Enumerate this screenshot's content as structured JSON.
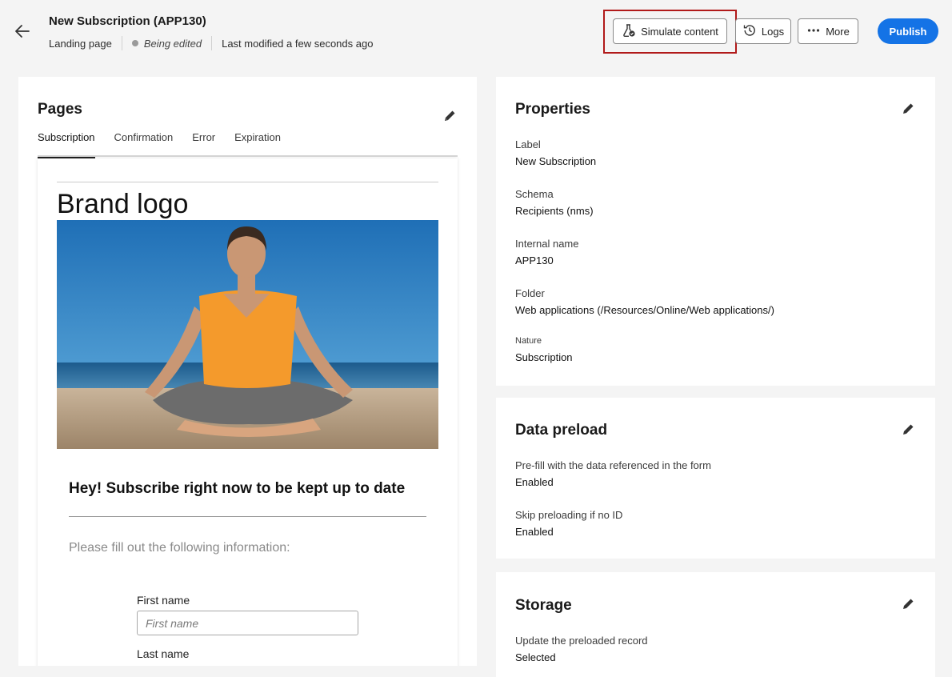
{
  "header": {
    "title": "New Subscription (APP130)",
    "type": "Landing page",
    "status": "Being edited",
    "last_modified": "Last modified a few seconds ago",
    "buttons": {
      "simulate": "Simulate content",
      "logs": "Logs",
      "more": "More",
      "publish": "Publish"
    }
  },
  "pages": {
    "heading": "Pages",
    "tabs": [
      "Subscription",
      "Confirmation",
      "Error",
      "Expiration"
    ],
    "active_tab": "Subscription",
    "preview": {
      "brand_logo": "Brand logo",
      "headline": "Hey! Subscribe right now to be kept up to date",
      "intro": "Please fill out the following information:",
      "first_name_label": "First name",
      "first_name_placeholder": "First name",
      "last_name_label": "Last name"
    }
  },
  "properties": {
    "heading": "Properties",
    "items": [
      {
        "label": "Label",
        "value": "New Subscription"
      },
      {
        "label": "Schema",
        "value": "Recipients (nms)"
      },
      {
        "label": "Internal name",
        "value": "APP130"
      },
      {
        "label": "Folder",
        "value": "Web applications (/Resources/Online/Web applications/)"
      },
      {
        "label": "Nature",
        "value": "Subscription"
      }
    ]
  },
  "data_preload": {
    "heading": "Data preload",
    "items": [
      {
        "label": "Pre-fill with the data referenced in the form",
        "value": "Enabled"
      },
      {
        "label": "Skip preloading if no ID",
        "value": "Enabled"
      }
    ]
  },
  "storage": {
    "heading": "Storage",
    "items": [
      {
        "label": "Update the preloaded record",
        "value": "Selected"
      }
    ]
  },
  "colors": {
    "accent": "#1473e6",
    "highlight": "#b11a1a"
  },
  "icons": {
    "back": "arrow-left-icon",
    "simulate": "flask-icon",
    "logs": "history-icon",
    "more": "more-dots-icon",
    "edit": "pencil-icon"
  }
}
